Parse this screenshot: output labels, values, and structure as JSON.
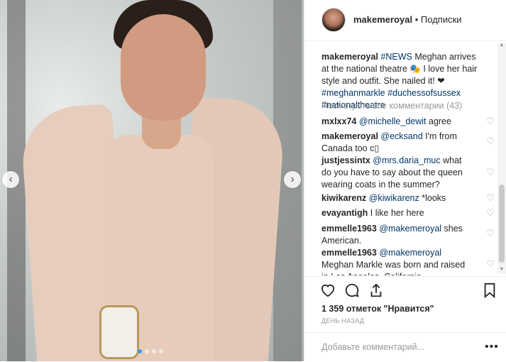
{
  "post": {
    "username": "makemeroyal",
    "separator": " • ",
    "follow_label": "Подписки"
  },
  "photo": {
    "prev_arrow": "‹",
    "next_arrow": "›",
    "carousel_dots": 4,
    "active_dot": 0
  },
  "caption": {
    "username": "makemeroyal",
    "hashtag_news": "#NEWS",
    "text": " Meghan arrives at the national theatre 🎭 I love her hair style and outfit. She nailed it! ❤ ",
    "tags": "#meghanmarkle #duchessofsussex #nationaltheatre"
  },
  "view_all_comments": "Посмотреть все комментарии (43)",
  "comments": [
    {
      "user": "mxlxx74",
      "mention": "@michelle_dewit",
      "text": " agree"
    },
    {
      "user": "makemeroyal",
      "mention": "@ecksand",
      "text": " I'm from Canada too c▯"
    },
    {
      "user": "justjessintx",
      "mention": "@mrs.daria_muc",
      "text": " what do you have to say about the queen wearing coats in the summer?"
    },
    {
      "user": "kiwikarenz",
      "mention": "@kiwikarenz",
      "text": " *looks"
    },
    {
      "user": "evayantigh",
      "mention": "",
      "text": "I like her here"
    },
    {
      "user": "emmelle1963",
      "mention": "@makemeroyal",
      "text": " shes American."
    },
    {
      "user": "emmelle1963",
      "mention": "@makemeroyal",
      "text": " Meghan Markle was born and raised in Los Angeles, California"
    }
  ],
  "actions": {
    "like_icon": "heart-icon",
    "comment_icon": "comment-icon",
    "share_icon": "share-icon",
    "save_icon": "bookmark-icon"
  },
  "likes_text": "1 359 отметок \"Нравится\"",
  "time_text": "ДЕНЬ НАЗАД",
  "add_comment_placeholder": "Добавьте комментарий...",
  "more_label": "•••",
  "scroll_up": "▲",
  "scroll_down": "▼",
  "colors": {
    "link": "#003569",
    "muted": "#999999",
    "text": "#262626",
    "border": "#efefef"
  }
}
